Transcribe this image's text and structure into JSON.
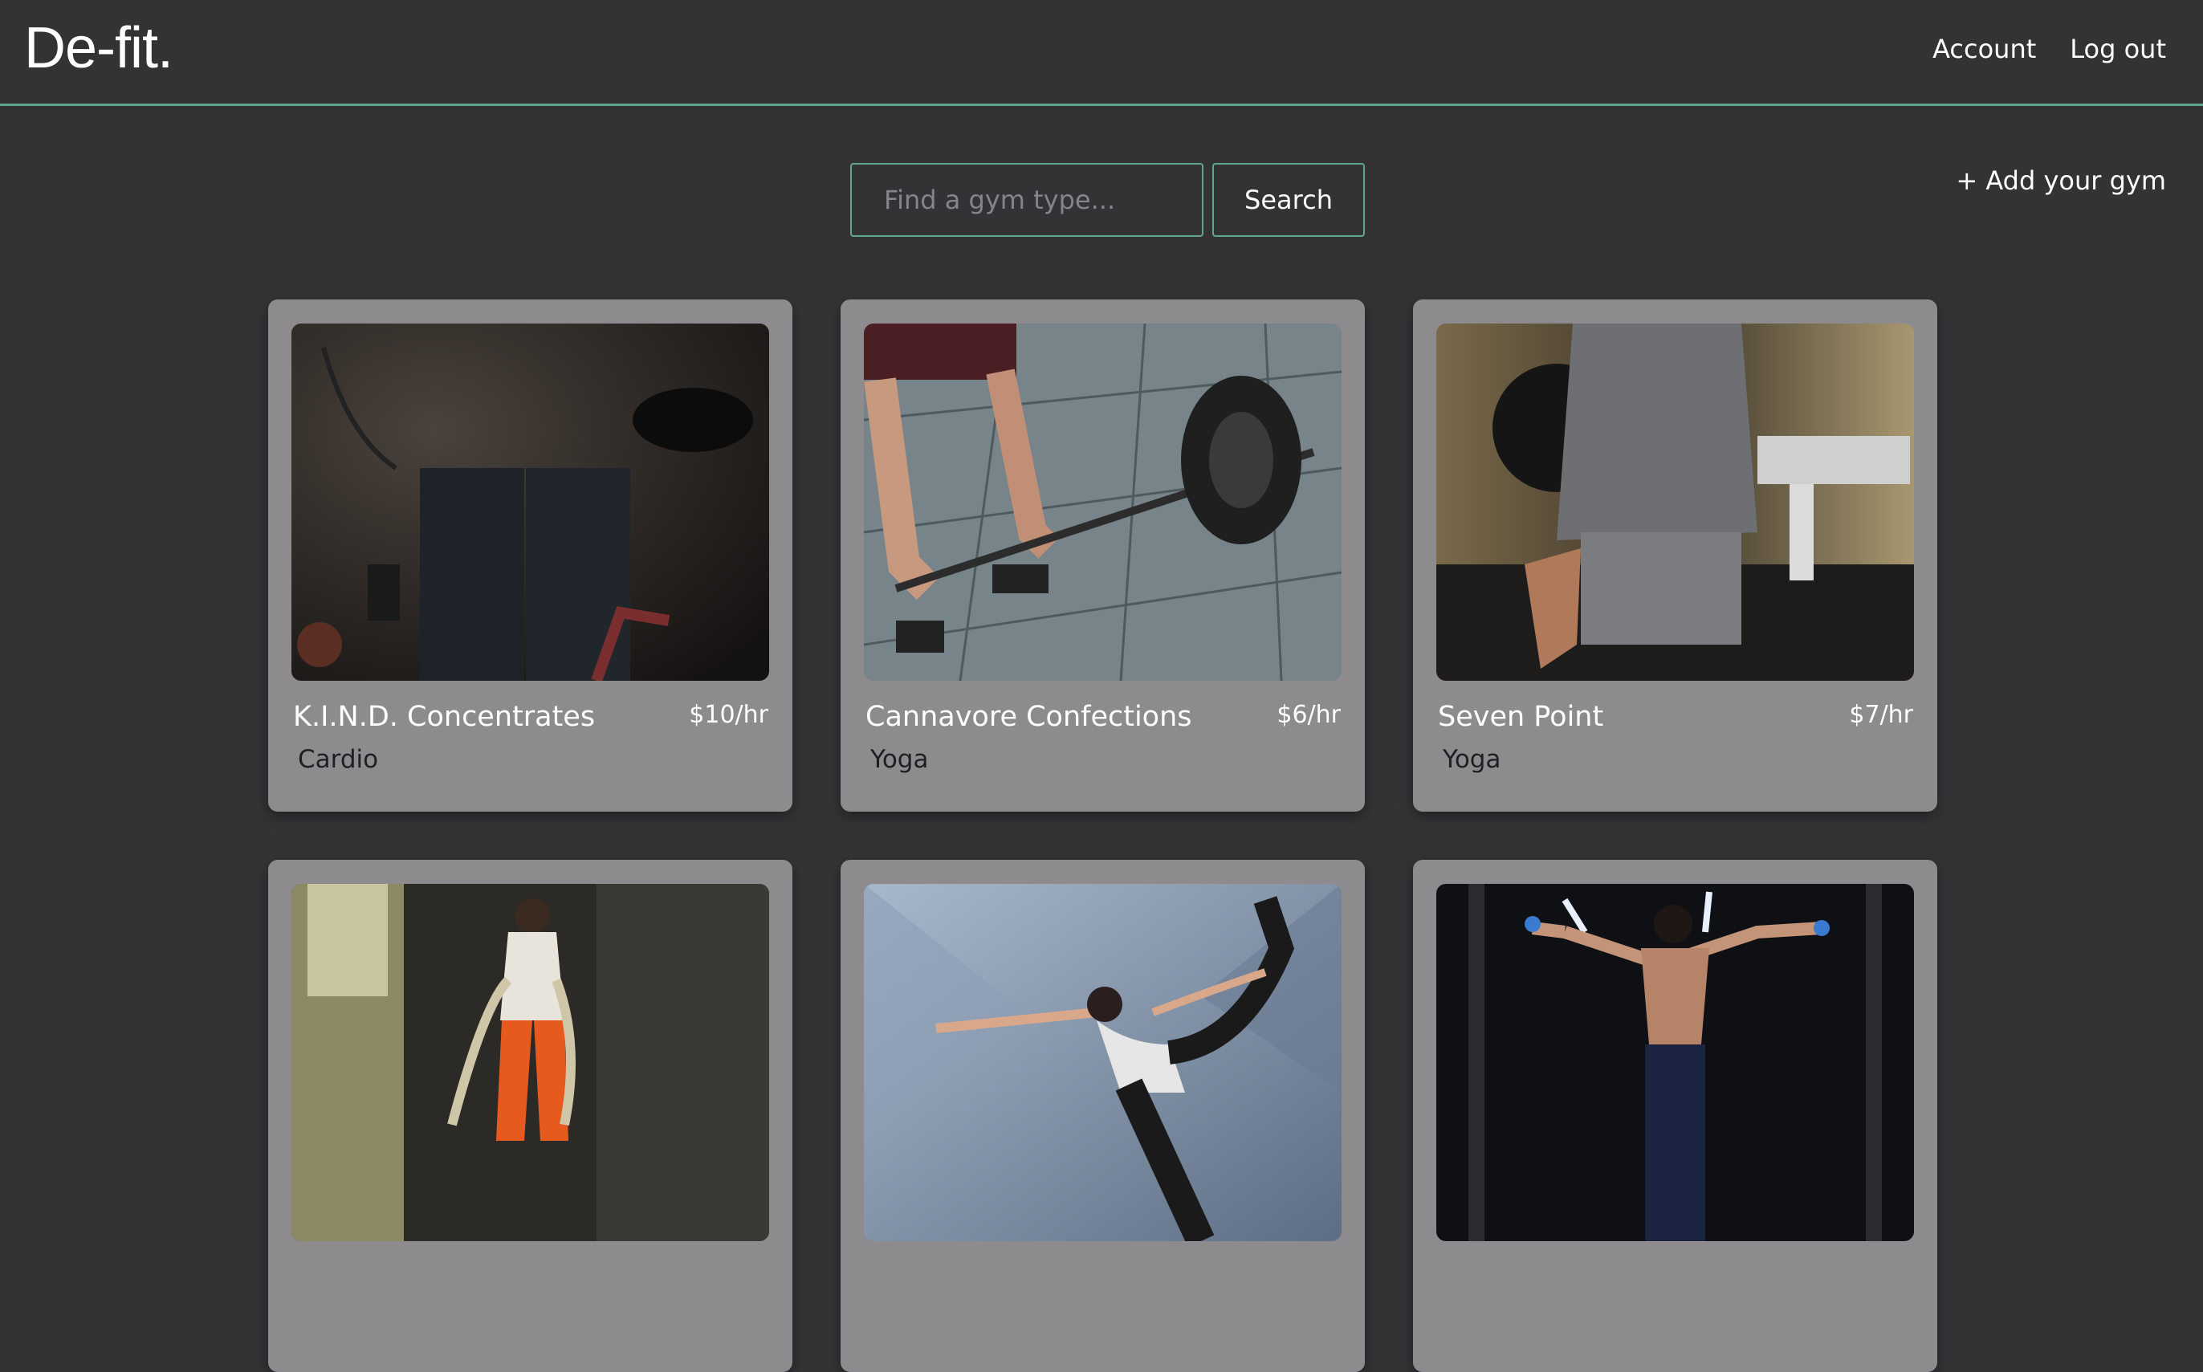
{
  "header": {
    "logo": "De-fit.",
    "nav": {
      "account": "Account",
      "logout": "Log out"
    }
  },
  "search": {
    "placeholder": "Find a gym type...",
    "button_label": "Search",
    "add_gym_label": "+ Add your gym"
  },
  "gyms": [
    {
      "name": "K.I.N.D. Concentrates",
      "price": "$10/hr",
      "type": "Cardio"
    },
    {
      "name": "Cannavore Confections",
      "price": "$6/hr",
      "type": "Yoga"
    },
    {
      "name": "Seven Point",
      "price": "$7/hr",
      "type": "Yoga"
    },
    {
      "name": "",
      "price": "",
      "type": ""
    },
    {
      "name": "",
      "price": "",
      "type": ""
    },
    {
      "name": "",
      "price": "",
      "type": ""
    }
  ],
  "colors": {
    "background": "#333235",
    "accent": "#5fa58f",
    "card": "#8e8b8f"
  }
}
